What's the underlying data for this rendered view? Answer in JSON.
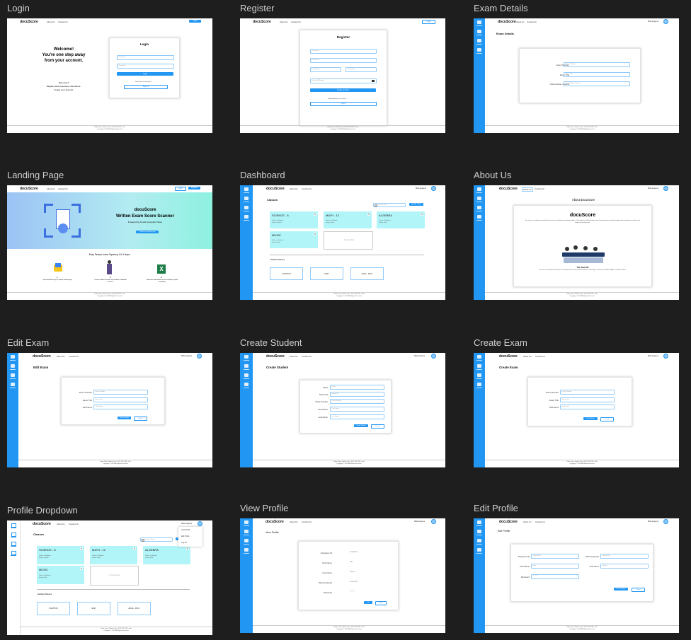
{
  "colors": {
    "accent": "#2196f3",
    "class_card": "#b2f5f8",
    "background": "#1e1e1e"
  },
  "brand": "docuScore",
  "nav": {
    "about": "About Us",
    "contact": "Contact Us",
    "user": "Mike Eugene"
  },
  "footer": {
    "line1": "Ruby Tower, Makati City • 0912 345 6789 • Info",
    "line2": "Copyright © 2024 All Rights Reserved"
  },
  "frames": {
    "login": "Login",
    "register": "Register",
    "exam_details": "Exam Details",
    "landing": "Landing Page",
    "dashboard": "Dashboard",
    "about": "About Us",
    "edit_exam": "Edit Exam",
    "create_student": "Create Student",
    "create_exam": "Create Exam",
    "profile_dropdown": "Profile Dropdown",
    "view_profile": "View Profile",
    "edit_profile": "Edit Profile"
  },
  "login": {
    "welcome1": "Welcome!",
    "welcome2": "You're one step away",
    "welcome3": "from your account.",
    "newhere": "New here?",
    "newhere2": "Register and experience docuScore.",
    "newhere3": "Create your account.",
    "title": "Login",
    "username_ph": "Username",
    "password_ph": "Password",
    "login_btn": "Login",
    "noacct": "Don't have an account?",
    "signup_btn": "Sign up",
    "nav_login": "Login"
  },
  "register": {
    "title": "Register",
    "username_ph": "Username",
    "password_ph": "Password",
    "first_ph": "First Name",
    "last_ph": "Last Name",
    "id_ph": "Upload ID/Badge",
    "create_btn": "Create account",
    "have": "Already have an account?",
    "login_btn": "Log in",
    "nav_login": "Login"
  },
  "exam_details": {
    "title": "Exam Details",
    "labels": [
      "Exam Number",
      "Exam Title",
      "Total Number of Items"
    ],
    "placeholders": [
      "Exam Number",
      "Exam Title",
      "Total Number of Items"
    ]
  },
  "landing": {
    "brand": "docuScore",
    "tagline": "Written Exam Score Scanner",
    "sub": "Powered by AI and Computer Vision",
    "cta": "Create an account to use",
    "steps_title": "Easy Peasy Lemon Squeezy: It's 3 steps.",
    "step1": "1",
    "step1t": "Open docuScore by its phone camera app.",
    "step2": "2",
    "step2t": "Create student records and students' individual answers.",
    "step3": "3",
    "step3t": "Generate and finalize on your desktop, export everything.",
    "login": "Login",
    "register": "Register"
  },
  "sidebar": [
    "Home",
    "Create Class",
    "Exam",
    "Create Student"
  ],
  "dashboard": {
    "title": "Classes",
    "search_ph": "Search Class",
    "create_btn": "Create Class",
    "classes": [
      {
        "name": "SCIENCE - 8",
        "d1": "Total no. of Students",
        "d2": "Section: Einstein"
      },
      {
        "name": "MATH - 12",
        "d1": "Total no. of Students",
        "d2": "Section: Gauss"
      },
      {
        "name": "ALGEBRA",
        "d1": "Total no. of Students",
        "d2": "Section: Rizal"
      },
      {
        "name": "MUSIC",
        "d1": "Total no. of Students",
        "d2": "Section: Rizal"
      }
    ],
    "create_card": "+ Create Class",
    "inactive_title": "Inactive Classes",
    "inactive": [
      "FILIPINO",
      "ESP",
      "ARAL. PAN."
    ]
  },
  "about": {
    "title": "About docuScore",
    "brand": "docuScore",
    "p1": "Docuscore is a solution conceived by team who all contribute to the growing number of IT graduates in the Education sector. Recognizing the strain of grading written examinations, it reduces the burden on teachers' time.",
    "team_title": "The Team ###",
    "p2": "The team is composed of 4 third-year IT students from the City of Makati Institute of Technology - University. Chad Martin Aguirre and their advisers."
  },
  "edit_exam": {
    "title": "Edit Exam",
    "labels": [
      "Exam Number",
      "Exam Title",
      "Total Items"
    ],
    "placeholders": [
      "Exam Number",
      "Exam Title",
      "Total Items"
    ],
    "save": "Save Changes",
    "cancel": "Cancel"
  },
  "create_student": {
    "title": "Create Student",
    "labels": [
      "Class",
      "School ID",
      "Class Number",
      "First Name",
      "Last Name"
    ],
    "placeholders": [
      "Class",
      "School ID",
      "Class Number",
      "First Name",
      "Last Name"
    ],
    "create": "Create Student",
    "cancel": "Cancel"
  },
  "create_exam": {
    "title": "Create Exam",
    "labels": [
      "Exam Number",
      "Exam Title",
      "Total Items"
    ],
    "placeholders": [
      "Exam Number",
      "Exam Title",
      "Total Items"
    ],
    "create": "Create Exam",
    "cancel": "Cancel"
  },
  "profile_dropdown": {
    "items": [
      "View Profile",
      "Edit Profile",
      "Log out"
    ]
  },
  "view_profile": {
    "title": "View Profile",
    "labels": [
      "Employee ID",
      "First Name",
      "Last Name",
      "Date Employed",
      "Password"
    ],
    "values": [
      "123456789",
      "Mike",
      "Eugene",
      "01/01/2020",
      "********"
    ],
    "edit": "Edit",
    "delete": "Delete"
  },
  "edit_profile": {
    "title": "Edit Profile",
    "labels": [
      "Employee ID",
      "First Name",
      "Password",
      "Date Employed",
      "Last Name"
    ],
    "placeholders": [
      "123456789",
      "Mike",
      "********",
      "01/01/2020",
      "Eugene"
    ],
    "save": "Save Changes",
    "cancel": "Cancel"
  }
}
